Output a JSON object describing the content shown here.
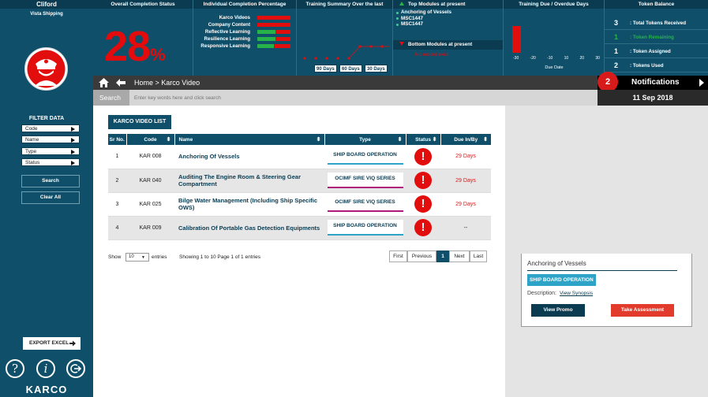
{
  "user": {
    "name": "Cliford",
    "company": "Vista Shipping"
  },
  "filter": {
    "title": "FILTER DATA",
    "items": [
      {
        "label": "Code"
      },
      {
        "label": "Name"
      },
      {
        "label": "Type"
      },
      {
        "label": "Status"
      }
    ],
    "search_label": "Search",
    "clear_label": "Clear All"
  },
  "export_label": "EXPORT EXCEL",
  "logo_text": "KARCO",
  "dashboard": {
    "completion": {
      "title": "Overall Completion Status",
      "value": "28",
      "unit": "%"
    },
    "individual": {
      "title": "Individual Completion Percentage",
      "rows": [
        {
          "label": "Karco Videos",
          "fraction": 0.0,
          "color": "#e20d0d"
        },
        {
          "label": "Company Content",
          "fraction": 0.0,
          "color": "#e20d0d"
        },
        {
          "label": "Reflective Learning",
          "fraction": 0.55,
          "color": "#27b34a"
        },
        {
          "label": "Resilience Learning",
          "fraction": 0.55,
          "color": "#27b34a"
        },
        {
          "label": "Responsive Learning",
          "fraction": 0.5,
          "color": "#27b34a"
        }
      ]
    },
    "training_summary": {
      "title": "Training Summary Over the last",
      "buttons": [
        "90 Days",
        "60 Days",
        "30 Days"
      ]
    },
    "top_modules": {
      "title": "Top Modules at present",
      "items": [
        "Anchoring of Vessels",
        "MSC1447",
        "MSC1447"
      ],
      "bottom_title": "Bottom Modules at present",
      "bottom_empty": "No record exist"
    },
    "training_due": {
      "title": "Training Due / Overdue Days",
      "ticks": [
        "-30",
        "-20",
        "-10",
        "10",
        "20",
        "30"
      ],
      "axis_label": "Due Date"
    },
    "tokens": {
      "title": "Token Balance",
      "rows": [
        {
          "num": "3",
          "label": ": Total Tokens Received",
          "color": "#ffffff"
        },
        {
          "num": "1",
          "label": ": Token Remaining",
          "color": "#27b34a"
        },
        {
          "num": "1",
          "label": ": Token Assigned",
          "color": "#ffffff"
        },
        {
          "num": "2",
          "label": ": Tokens Used",
          "color": "#ffffff"
        }
      ]
    }
  },
  "breadcrumb": "Home > Karco Video",
  "search": {
    "label": "Search",
    "placeholder": "Enter key words here and click search"
  },
  "notifications": {
    "count": "2",
    "label": "Notifications"
  },
  "date": "11 Sep 2018",
  "list": {
    "title": "KARCO VIDEO LIST",
    "columns": [
      "Sr No.",
      "Code",
      "Name",
      "Type",
      "Status",
      "Due In/By"
    ],
    "rows": [
      {
        "sr": "1",
        "code": "KAR 008",
        "name": "Anchoring Of Vessels",
        "type": "SHIP BOARD OPERATION",
        "due": "29  Days"
      },
      {
        "sr": "2",
        "code": "KAR 040",
        "name": "Auditing The Engine Room & Steering Gear Compartment",
        "type": "OCIMF SIRE VIQ SERIES",
        "due": "29  Days"
      },
      {
        "sr": "3",
        "code": "KAR 025",
        "name": "Bilge Water Management (Including Ship Specific OWS)",
        "type": "OCIMF SIRE VIQ SERIES",
        "due": "29  Days"
      },
      {
        "sr": "4",
        "code": "KAR 009",
        "name": "Calibration Of Portable Gas Detection Equipments",
        "type": "SHIP BOARD OPERATION",
        "due": "--"
      }
    ],
    "show_label": "Show",
    "show_value": "10",
    "entries_label": "entries",
    "info": "Showing 1 to 10   Page 1 of 1 entries",
    "pager": {
      "first": "First",
      "previous": "Previous",
      "current": "1",
      "next": "Next",
      "last": "Last"
    }
  },
  "detail": {
    "title": "Anchoring of Vessels",
    "tag": "SHIP BOARD OPERATION",
    "desc_label": "Description:",
    "synopsis_link": "View Synopsis",
    "promo_label": "View Promo",
    "assessment_label": "Take Assessment"
  }
}
